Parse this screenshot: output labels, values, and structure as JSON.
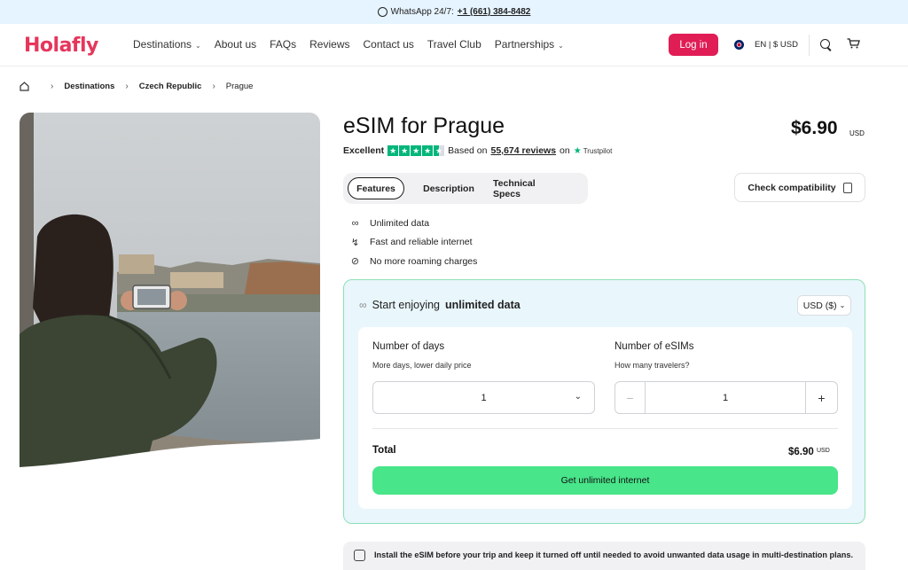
{
  "topbar": {
    "prefix": "WhatsApp 24/7:",
    "phone": "+1 (661) 384-8482",
    "icon": "whatsapp-icon"
  },
  "header": {
    "logo": "Holafly",
    "nav": [
      {
        "label": "Destinations",
        "dropdown": true
      },
      {
        "label": "About us"
      },
      {
        "label": "FAQs"
      },
      {
        "label": "Reviews"
      },
      {
        "label": "Contact us"
      },
      {
        "label": "Travel Club"
      },
      {
        "label": "Partnerships",
        "dropdown": true
      }
    ],
    "login": "Log in",
    "locale": "EN | $ USD",
    "brand_color": "#e01d55"
  },
  "breadcrumb": {
    "items": [
      "Destinations",
      "Czech Republic",
      "Prague"
    ]
  },
  "product": {
    "title": "eSIM for Prague",
    "price": "$6.90",
    "price_currency": "USD",
    "rating_word": "Excellent",
    "based_on": "Based on",
    "review_count": "55,674 reviews",
    "on": "on",
    "trustpilot": "Trustpilot",
    "stars": 4.5,
    "tabs": [
      "Features",
      "Description",
      "Technical Specs"
    ],
    "check_compat": "Check compatibility",
    "features": [
      {
        "icon": "infinity-icon",
        "text": "Unlimited data"
      },
      {
        "icon": "lightning-icon",
        "text": "Fast and reliable internet"
      },
      {
        "icon": "no-roaming-icon",
        "text": "No more roaming charges"
      }
    ]
  },
  "plan": {
    "heading_prefix": "Start enjoying",
    "heading_bold": "unlimited data",
    "currency": "USD ($)",
    "days_label": "Number of days",
    "days_sub": "More days, lower daily price",
    "days_value": "1",
    "esims_label": "Number of eSIMs",
    "esims_sub": "How many travelers?",
    "esims_value": "1",
    "total_label": "Total",
    "total_value": "$6.90",
    "total_currency": "USD",
    "cta": "Get unlimited internet",
    "cta_color": "#48e58a"
  },
  "notice": "Install the eSIM before your trip and keep it turned off until needed to avoid unwanted data usage in multi-destination plans."
}
